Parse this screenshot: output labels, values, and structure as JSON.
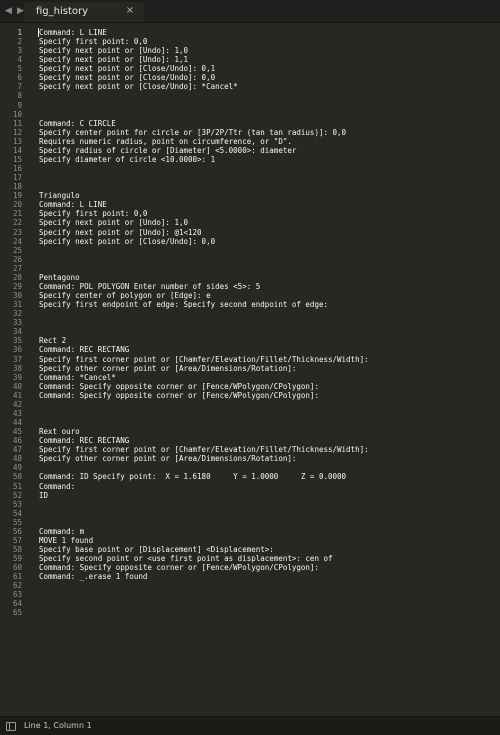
{
  "tab": {
    "title": "fig_history",
    "close_glyph": "×"
  },
  "nav": {
    "back_glyph": "◀",
    "forward_glyph": "▶"
  },
  "editor": {
    "active_line": 1,
    "lines": [
      "Command: L LINE",
      "Specify first point: 0,0",
      "Specify next point or [Undo]: 1,0",
      "Specify next point or [Undo]: 1,1",
      "Specify next point or [Close/Undo]: 0,1",
      "Specify next point or [Close/Undo]: 0,0",
      "Specify next point or [Close/Undo]: *Cancel*",
      "",
      "",
      "",
      "Command: C CIRCLE",
      "Specify center point for circle or [3P/2P/Ttr (tan tan radius)]: 0,0",
      "Requires numeric radius, point on circumference, or \"D\".",
      "Specify radius of circle or [Diameter] <5.0000>: diameter",
      "Specify diameter of circle <10.0000>: 1",
      "",
      "",
      "",
      "Triangulo",
      "Command: L LINE",
      "Specify first point: 0,0",
      "Specify next point or [Undo]: 1,0",
      "Specify next point or [Undo]: @1<120",
      "Specify next point or [Close/Undo]: 0,0",
      "",
      "",
      "",
      "Pentagono",
      "Command: POL POLYGON Enter number of sides <5>: 5",
      "Specify center of polygon or [Edge]: e",
      "Specify first endpoint of edge: Specify second endpoint of edge:",
      "",
      "",
      "",
      "Rect 2",
      "Command: REC RECTANG",
      "Specify first corner point or [Chamfer/Elevation/Fillet/Thickness/Width]:",
      "Specify other corner point or [Area/Dimensions/Rotation]:",
      "Command: *Cancel*",
      "Command: Specify opposite corner or [Fence/WPolygon/CPolygon]:",
      "Command: Specify opposite corner or [Fence/WPolygon/CPolygon]:",
      "",
      "",
      "",
      "Rext ouro",
      "Command: REC RECTANG",
      "Specify first corner point or [Chamfer/Elevation/Fillet/Thickness/Width]:",
      "Specify other corner point or [Area/Dimensions/Rotation]:",
      "",
      "Command: ID Specify point:  X = 1.6180     Y = 1.0000     Z = 0.0000",
      "Command:",
      "ID",
      "",
      "",
      "",
      "Command: m",
      "MOVE 1 found",
      "Specify base point or [Displacement] <Displacement>:",
      "Specify second point or <use first point as displacement>: cen of",
      "Command: Specify opposite corner or [Fence/WPolygon/CPolygon]:",
      "Command: _.erase 1 found",
      "",
      "",
      "",
      ""
    ]
  },
  "status": {
    "position_text": "Line 1, Column 1"
  },
  "colors": {
    "background": "#272822",
    "text": "#f8f8f2",
    "line_number": "#8f908a"
  }
}
